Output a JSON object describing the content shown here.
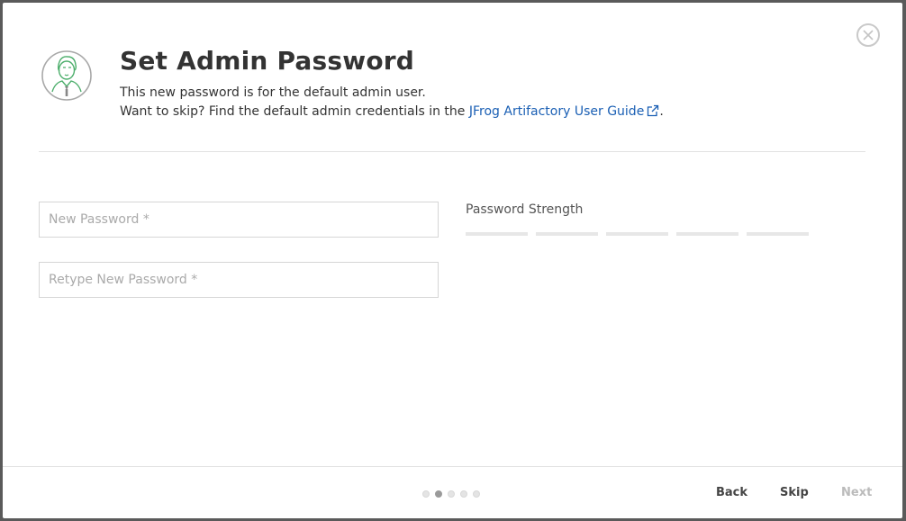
{
  "dialog": {
    "title": "Set Admin Password",
    "description_line1": "This new password is for the default admin user.",
    "description_line2_prefix": "Want to skip? Find the default admin credentials in the ",
    "guide_link_label": "JFrog Artifactory User Guide",
    "description_line2_suffix": "."
  },
  "form": {
    "new_password": {
      "placeholder": "New Password *",
      "value": ""
    },
    "retype_password": {
      "placeholder": "Retype New Password *",
      "value": ""
    },
    "strength_label": "Password Strength",
    "strength_segments": 5,
    "strength_level": 0
  },
  "wizard": {
    "steps": 5,
    "current_step": 2
  },
  "footer": {
    "back_label": "Back",
    "skip_label": "Skip",
    "next_label": "Next"
  },
  "icons": {
    "close": "close-icon",
    "avatar": "admin-user-avatar-icon",
    "external": "external-link-icon"
  },
  "colors": {
    "link": "#1a5fb4",
    "avatar_green": "#4cae6b"
  }
}
